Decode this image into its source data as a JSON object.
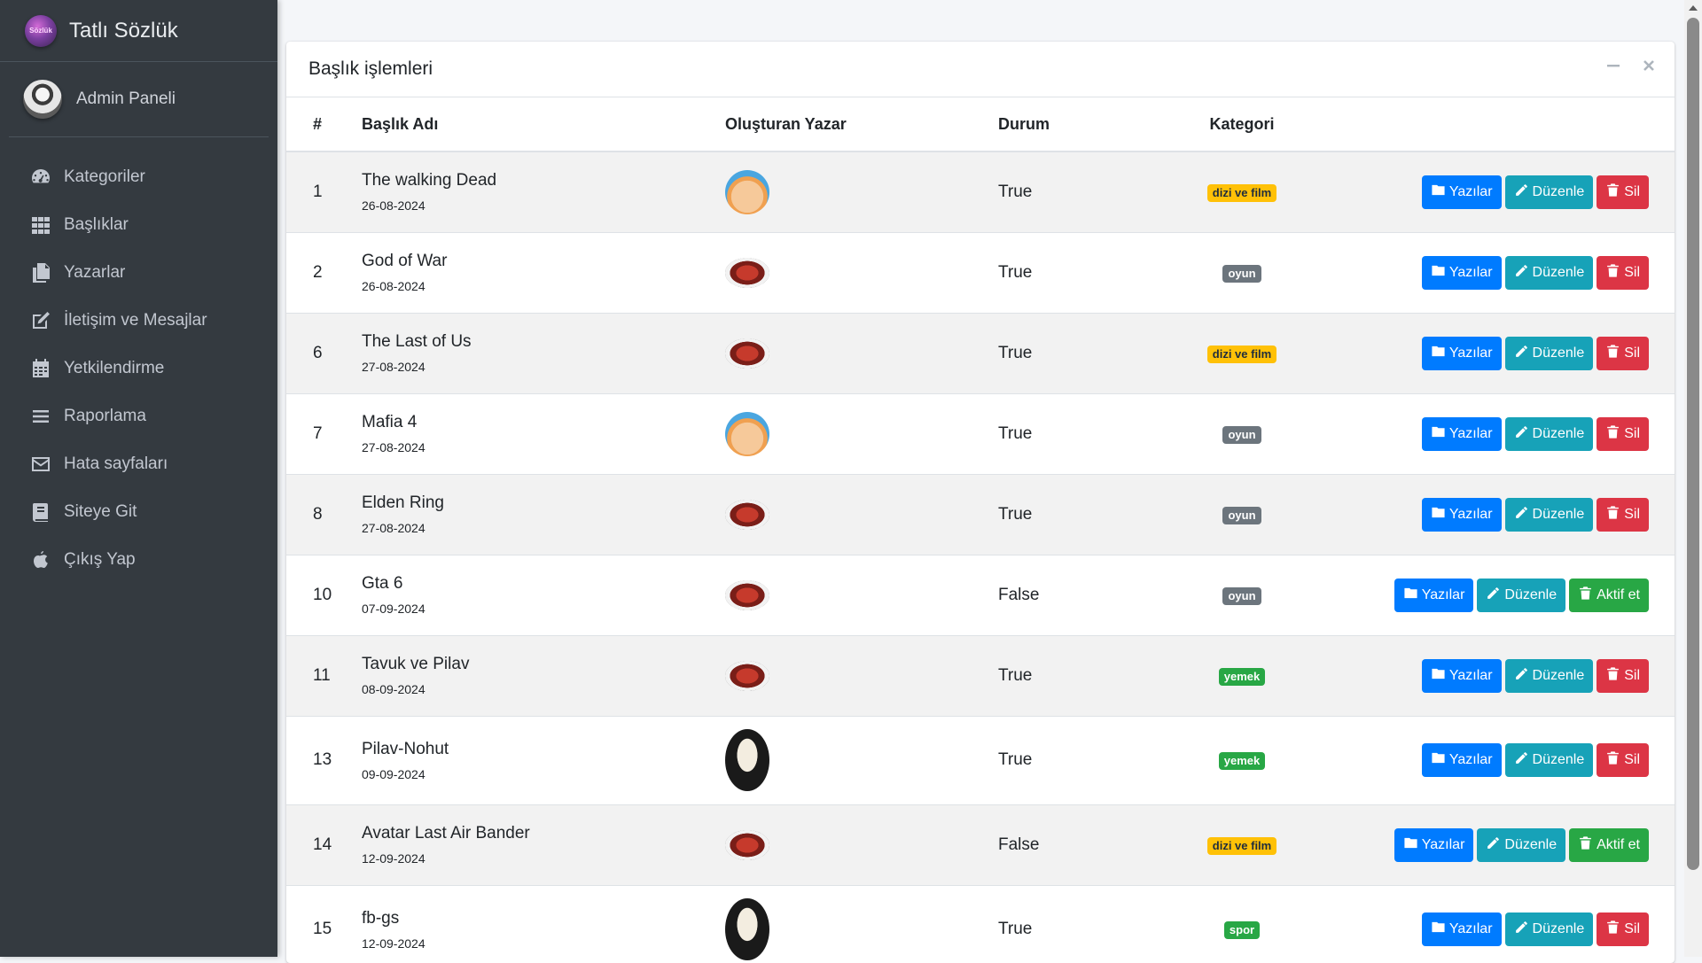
{
  "brand": {
    "name": "Tatlı Sözlük",
    "logo_text": "Sözlük"
  },
  "user": {
    "name": "Admin Paneli"
  },
  "sidebar": {
    "items": [
      {
        "label": "Kategoriler",
        "icon": "dashboard-icon"
      },
      {
        "label": "Başlıklar",
        "icon": "grid-icon"
      },
      {
        "label": "Yazarlar",
        "icon": "copy-icon"
      },
      {
        "label": "İletişim ve Mesajlar",
        "icon": "edit-icon"
      },
      {
        "label": "Yetkilendirme",
        "icon": "calendar-icon"
      },
      {
        "label": "Raporlama",
        "icon": "list-icon"
      },
      {
        "label": "Hata sayfaları",
        "icon": "envelope-icon"
      },
      {
        "label": "Siteye Git",
        "icon": "book-icon"
      },
      {
        "label": "Çıkış Yap",
        "icon": "apple-icon"
      }
    ]
  },
  "card": {
    "title": "Başlık işlemleri",
    "columns": [
      "#",
      "Başlık Adı",
      "Oluşturan Yazar",
      "Durum",
      "Kategori"
    ],
    "rows": [
      {
        "id": "1",
        "title": "The walking Dead",
        "date": "26-08-2024",
        "avatar": "aang",
        "status": "True",
        "category": "dizi ve film",
        "cat_style": "warning",
        "actions": [
          "Yazılar",
          "Düzenle",
          "Sil"
        ]
      },
      {
        "id": "2",
        "title": "God of War",
        "date": "26-08-2024",
        "avatar": "crab",
        "status": "True",
        "category": "oyun",
        "cat_style": "secondary",
        "actions": [
          "Yazılar",
          "Düzenle",
          "Sil"
        ]
      },
      {
        "id": "6",
        "title": "The Last of Us",
        "date": "27-08-2024",
        "avatar": "crab",
        "status": "True",
        "category": "dizi ve film",
        "cat_style": "warning",
        "actions": [
          "Yazılar",
          "Düzenle",
          "Sil"
        ]
      },
      {
        "id": "7",
        "title": "Mafia 4",
        "date": "27-08-2024",
        "avatar": "aang",
        "status": "True",
        "category": "oyun",
        "cat_style": "secondary",
        "actions": [
          "Yazılar",
          "Düzenle",
          "Sil"
        ]
      },
      {
        "id": "8",
        "title": "Elden Ring",
        "date": "27-08-2024",
        "avatar": "crab",
        "status": "True",
        "category": "oyun",
        "cat_style": "secondary",
        "actions": [
          "Yazılar",
          "Düzenle",
          "Sil"
        ]
      },
      {
        "id": "10",
        "title": "Gta 6",
        "date": "07-09-2024",
        "avatar": "crab",
        "status": "False",
        "category": "oyun",
        "cat_style": "secondary",
        "actions": [
          "Yazılar",
          "Düzenle",
          "Aktif et"
        ]
      },
      {
        "id": "11",
        "title": "Tavuk ve Pilav",
        "date": "08-09-2024",
        "avatar": "crab",
        "status": "True",
        "category": "yemek",
        "cat_style": "success",
        "actions": [
          "Yazılar",
          "Düzenle",
          "Sil"
        ]
      },
      {
        "id": "13",
        "title": "Pilav-Nohut",
        "date": "09-09-2024",
        "avatar": "mask",
        "status": "True",
        "category": "yemek",
        "cat_style": "success",
        "actions": [
          "Yazılar",
          "Düzenle",
          "Sil"
        ]
      },
      {
        "id": "14",
        "title": "Avatar Last Air Bander",
        "date": "12-09-2024",
        "avatar": "crab",
        "status": "False",
        "category": "dizi ve film",
        "cat_style": "warning",
        "actions": [
          "Yazılar",
          "Düzenle",
          "Aktif et"
        ]
      },
      {
        "id": "15",
        "title": "fb-gs",
        "date": "12-09-2024",
        "avatar": "mask",
        "status": "True",
        "category": "spor",
        "cat_style": "success",
        "actions": [
          "Yazılar",
          "Düzenle",
          "Sil"
        ]
      }
    ]
  },
  "colors": {
    "sidebar_bg": "#343a40",
    "primary": "#007bff",
    "info": "#17a2b8",
    "danger": "#dc3545",
    "success": "#28a745",
    "warning": "#ffc107",
    "secondary": "#6c757d"
  }
}
